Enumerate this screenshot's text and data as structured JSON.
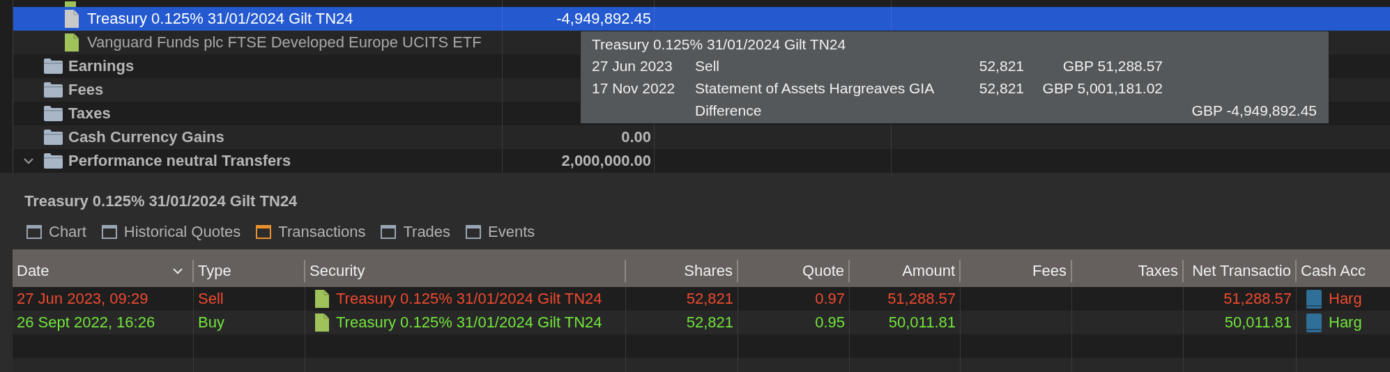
{
  "tree": {
    "items": [
      {
        "kind": "security",
        "label": "Treasury 0.125% 31/01/2024 Gilt TN24",
        "value": "-4,949,892.45",
        "selected": true
      },
      {
        "kind": "security",
        "label": "Vanguard Funds plc FTSE Developed Europe UCITS ETF",
        "selected": false
      },
      {
        "kind": "folder",
        "label": "Earnings",
        "selected": false
      },
      {
        "kind": "folder",
        "label": "Fees",
        "selected": false
      },
      {
        "kind": "folder",
        "label": "Taxes",
        "selected": false
      },
      {
        "kind": "folder",
        "label": "Cash Currency Gains",
        "value": "0.00",
        "selected": false
      },
      {
        "kind": "folder",
        "label": "Performance neutral Transfers",
        "value": "2,000,000.00",
        "selected": false,
        "expanded": true
      }
    ]
  },
  "tooltip": {
    "title": "Treasury 0.125% 31/01/2024 Gilt TN24",
    "rows": [
      {
        "date": "27 Jun 2023",
        "text": "Sell",
        "shares": "52,821",
        "amount": "GBP 51,288.57"
      },
      {
        "date": "17 Nov 2022",
        "text": "Statement of Assets Hargreaves GIA",
        "shares": "52,821",
        "amount": "GBP 5,001,181.02"
      }
    ],
    "difference": {
      "label": "Difference",
      "amount": "GBP -4,949,892.45"
    }
  },
  "detail": {
    "title": "Treasury 0.125% 31/01/2024 Gilt TN24",
    "tabs": [
      {
        "label": "Chart",
        "selected": false
      },
      {
        "label": "Historical Quotes",
        "selected": false
      },
      {
        "label": "Transactions",
        "selected": true
      },
      {
        "label": "Trades",
        "selected": false
      },
      {
        "label": "Events",
        "selected": false
      }
    ],
    "table": {
      "columns": [
        {
          "label": "Date",
          "kind": "date",
          "sorted": true
        },
        {
          "label": "Type",
          "kind": "text",
          "sorted": false
        },
        {
          "label": "Security",
          "kind": "security",
          "sorted": false
        },
        {
          "label": "Shares",
          "kind": "number",
          "sorted": false
        },
        {
          "label": "Quote",
          "kind": "number",
          "sorted": false
        },
        {
          "label": "Amount",
          "kind": "number",
          "sorted": false
        },
        {
          "label": "Fees",
          "kind": "number",
          "sorted": false
        },
        {
          "label": "Taxes",
          "kind": "number",
          "sorted": false
        },
        {
          "label": "Net Transactio",
          "kind": "number",
          "sorted": false
        },
        {
          "label": "Cash Acc",
          "kind": "account",
          "sorted": false
        }
      ],
      "rows": [
        {
          "kind": "sell",
          "cells": [
            "27 Jun 2023, 09:29",
            "Sell",
            "Treasury 0.125% 31/01/2024 Gilt TN24",
            "52,821",
            "0.97",
            "51,288.57",
            null,
            null,
            "51,288.57",
            "Harg"
          ]
        },
        {
          "kind": "buy",
          "cells": [
            "26 Sept 2022, 16:26",
            "Buy",
            "Treasury 0.125% 31/01/2024 Gilt TN24",
            "52,821",
            "0.95",
            "50,011.81",
            null,
            null,
            "50,011.81",
            "Harg"
          ]
        }
      ]
    }
  }
}
